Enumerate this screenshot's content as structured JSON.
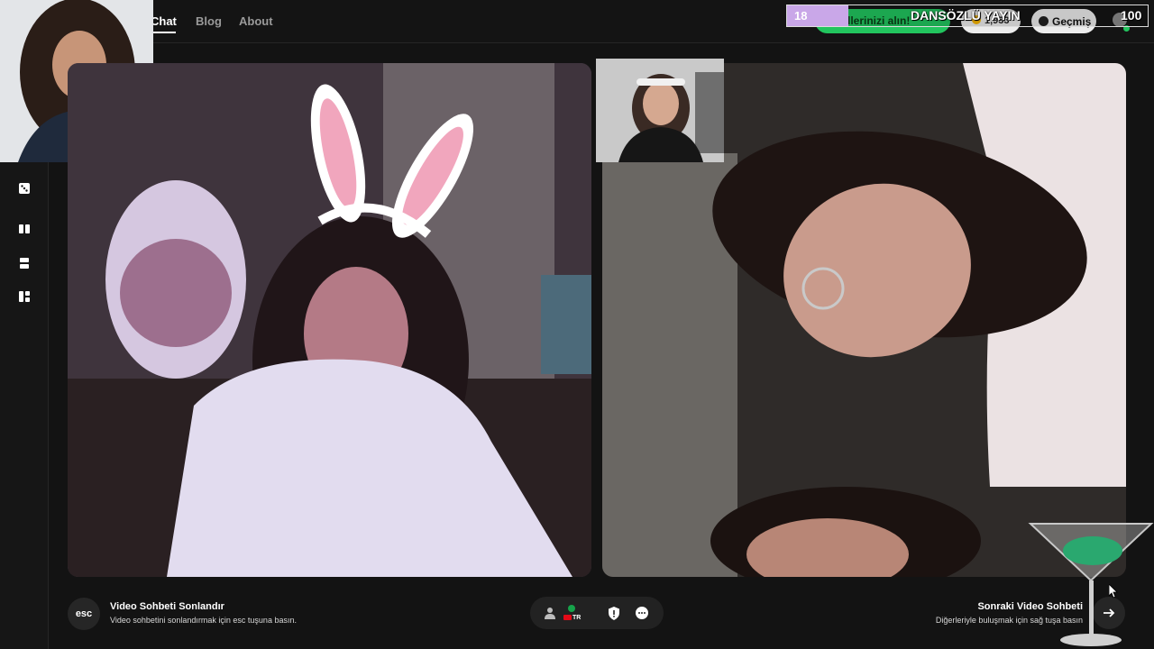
{
  "nav": {
    "chat": "Chat",
    "blog": "Blog",
    "about": "About"
  },
  "header": {
    "promo_label": "llerinizi alın!",
    "coin_balance": "1,933",
    "history_label": "Geçmiş"
  },
  "stream_overlay": {
    "left_number": "18",
    "title": "DANSÖZLÜ YAYIN",
    "right_number": "100"
  },
  "sidebar": {
    "icons": [
      "dice-icon",
      "columns-layout-icon",
      "rows-layout-icon",
      "grid-layout-icon"
    ]
  },
  "footer": {
    "esc_key": "esc",
    "end_title": "Video Sohbeti Sonlandır",
    "end_subtitle": "Video sohbetini sonlandırmak için esc tuşuna basın.",
    "country_code": "TR",
    "next_title": "Sonraki Video Sohbeti",
    "next_subtitle": "Diğerleriyle buluşmak için sağ tuşa basın"
  },
  "colors": {
    "accent_green": "#22c55e",
    "overlay_purple": "#c9a7e8",
    "background": "#131313"
  }
}
